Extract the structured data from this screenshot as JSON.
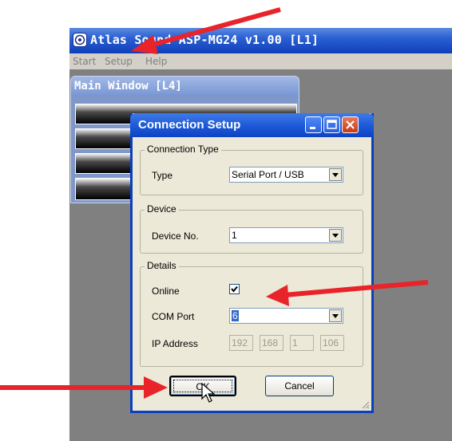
{
  "app": {
    "title": "Atlas Sound ASP-MG24 v1.00  [L1]",
    "menu": [
      "Start",
      "Setup",
      "Help"
    ]
  },
  "main_window": {
    "title": "Main Window [L4]",
    "rows": 4
  },
  "dialog": {
    "title": "Connection Setup",
    "connection_type": {
      "group_label": "Connection Type",
      "type_label": "Type",
      "type_value": "Serial Port / USB"
    },
    "device": {
      "group_label": "Device",
      "device_no_label": "Device No.",
      "device_no_value": "1"
    },
    "details": {
      "group_label": "Details",
      "online_label": "Online",
      "online_checked": true,
      "com_port_label": "COM Port",
      "com_port_value": "6",
      "ip_label": "IP Address",
      "ip": [
        "192",
        "168",
        "1",
        "106"
      ]
    },
    "ok_label": "OK",
    "cancel_label": "Cancel"
  },
  "colors": {
    "titlebar": "#0f3fb8",
    "dialog_bg": "#ece9d8",
    "arrow": "#e8232a",
    "desktop": "#808080"
  }
}
